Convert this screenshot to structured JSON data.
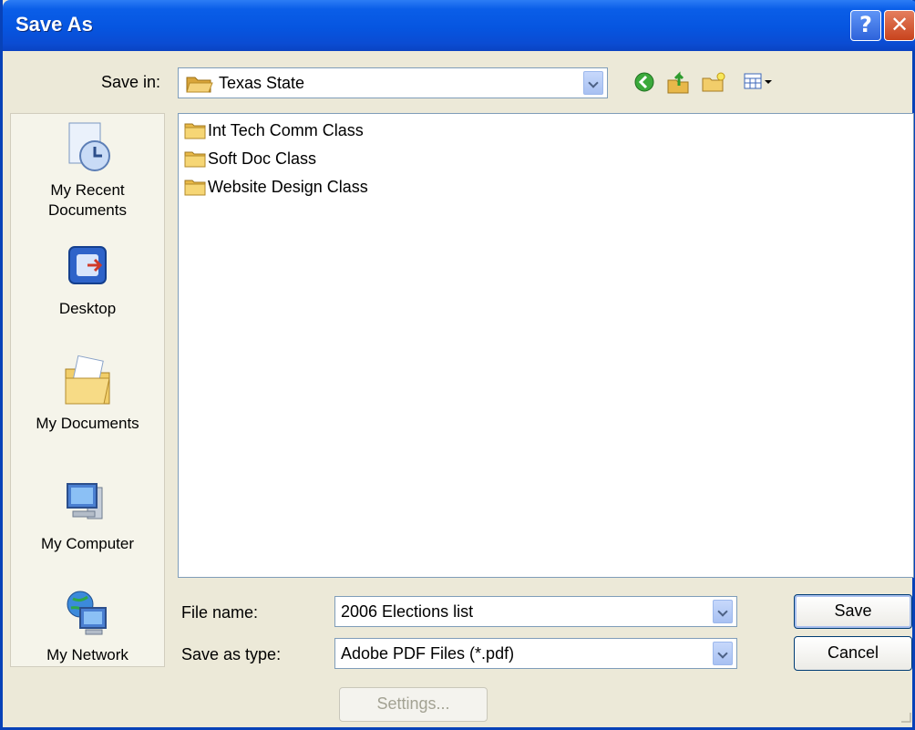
{
  "window": {
    "title": "Save As",
    "help_glyph": "?",
    "close_glyph": "✕"
  },
  "toolbar": {
    "save_in_label": "Save in:",
    "save_in_value": "Texas State",
    "icons": [
      "back-icon",
      "up-folder-icon",
      "new-folder-icon",
      "views-menu-icon"
    ]
  },
  "places": [
    {
      "label_lines": [
        "My Recent",
        "Documents"
      ],
      "icon": "recent-documents-icon"
    },
    {
      "label_lines": [
        "Desktop"
      ],
      "icon": "desktop-icon"
    },
    {
      "label_lines": [
        "My Documents"
      ],
      "icon": "my-documents-icon"
    },
    {
      "label_lines": [
        "My Computer"
      ],
      "icon": "my-computer-icon"
    },
    {
      "label_lines": [
        "My Network"
      ],
      "icon": "my-network-icon"
    }
  ],
  "files": [
    {
      "name": "Int Tech Comm Class",
      "type": "folder"
    },
    {
      "name": "Soft Doc Class",
      "type": "folder"
    },
    {
      "name": "Website Design Class",
      "type": "folder"
    }
  ],
  "form": {
    "file_name_label": "File name:",
    "file_name_value": "2006 Elections list",
    "save_as_type_label": "Save as type:",
    "save_as_type_value": "Adobe PDF Files (*.pdf)"
  },
  "buttons": {
    "save": "Save",
    "cancel": "Cancel",
    "settings": "Settings..."
  },
  "colors": {
    "titlebar": "#0655E0",
    "dialog_bg": "#ECE9D8",
    "field_border": "#7F9DB9"
  }
}
